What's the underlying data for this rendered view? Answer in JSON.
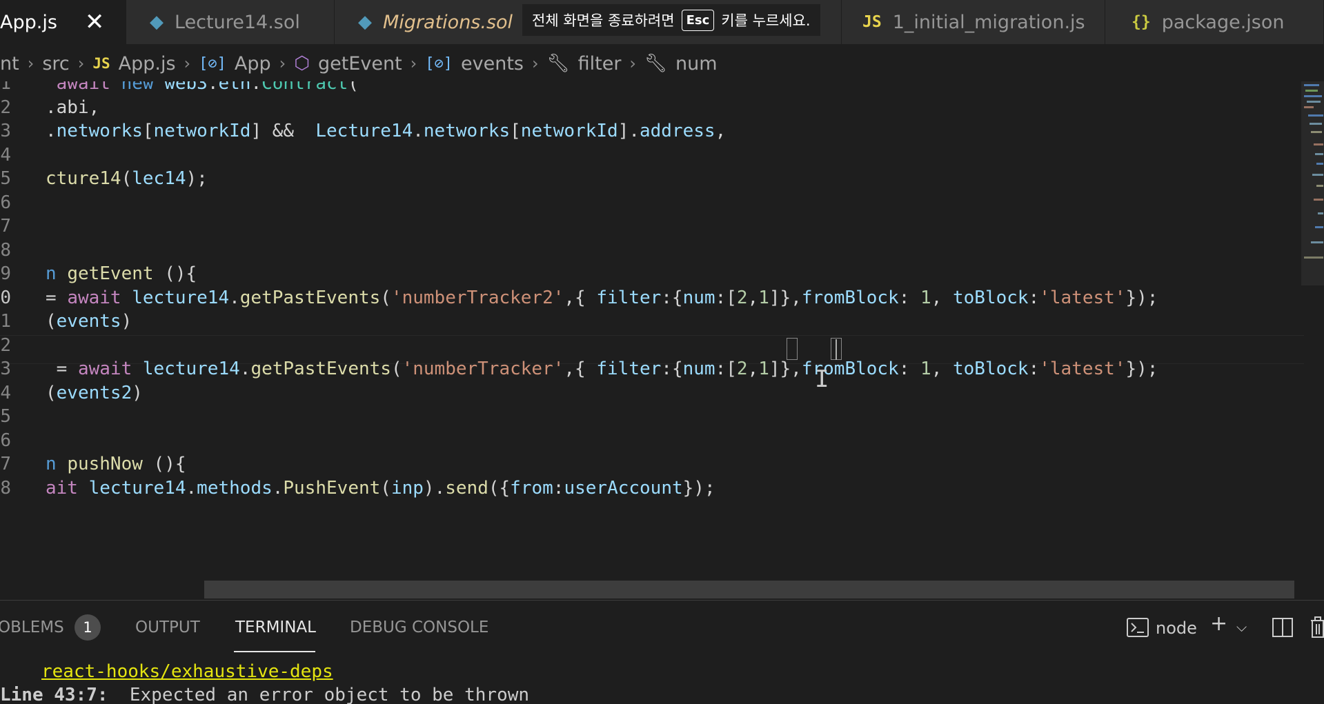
{
  "tabs": [
    {
      "label": "App.js",
      "icon": "JS",
      "kind": "js",
      "active": true
    },
    {
      "label": "Lecture14.sol",
      "icon": "◆",
      "kind": "sol",
      "active": false
    },
    {
      "label": "Migrations.sol",
      "icon": "◆",
      "kind": "sol",
      "active": false,
      "modified": true
    },
    {
      "label": "1_initial_migration.js",
      "icon": "JS",
      "kind": "js",
      "active": false
    },
    {
      "label": "package.json",
      "icon": "{}",
      "kind": "json",
      "active": false
    }
  ],
  "fullscreen_notice": {
    "before": "전체 화면을 종료하려면",
    "key": "Esc",
    "after": "키를 누르세요."
  },
  "breadcrumb": {
    "items": [
      "nt",
      "src",
      "App.js",
      "App",
      "getEvent",
      "events",
      "filter",
      "num"
    ],
    "js_badge": "JS"
  },
  "editor": {
    "line_numbers": [
      "1",
      "2",
      "3",
      "4",
      "5",
      "6",
      "7",
      "8",
      "9",
      "0",
      "1",
      "2",
      "3",
      "4",
      "5",
      "6",
      "7",
      "8"
    ],
    "current_line_index": 9,
    "lines": [
      [
        {
          "t": " await ",
          "c": "kw2"
        },
        {
          "t": "new ",
          "c": "kw"
        },
        {
          "t": "web3",
          "c": "vr"
        },
        {
          "t": ".",
          "c": "pu"
        },
        {
          "t": "eth",
          "c": "vr"
        },
        {
          "t": ".",
          "c": "pu"
        },
        {
          "t": "Contract",
          "c": "cl"
        },
        {
          "t": "(",
          "c": "pu"
        }
      ],
      [
        {
          "t": ".abi,",
          "c": "pu"
        }
      ],
      [
        {
          "t": ".",
          "c": "pu"
        },
        {
          "t": "networks",
          "c": "vr"
        },
        {
          "t": "[",
          "c": "pu"
        },
        {
          "t": "networkId",
          "c": "vr"
        },
        {
          "t": "] &&  ",
          "c": "pu"
        },
        {
          "t": "Lecture14",
          "c": "vr"
        },
        {
          "t": ".",
          "c": "pu"
        },
        {
          "t": "networks",
          "c": "vr"
        },
        {
          "t": "[",
          "c": "pu"
        },
        {
          "t": "networkId",
          "c": "vr"
        },
        {
          "t": "].",
          "c": "pu"
        },
        {
          "t": "address",
          "c": "vr"
        },
        {
          "t": ",",
          "c": "pu"
        }
      ],
      [],
      [
        {
          "t": "cture14",
          "c": "fn"
        },
        {
          "t": "(",
          "c": "pu"
        },
        {
          "t": "lec14",
          "c": "vr"
        },
        {
          "t": ");",
          "c": "pu"
        }
      ],
      [],
      [],
      [],
      [
        {
          "t": "n ",
          "c": "kw"
        },
        {
          "t": "getEvent",
          "c": "fn"
        },
        {
          "t": " (){",
          "c": "pu"
        }
      ],
      [
        {
          "t": "= ",
          "c": "pu"
        },
        {
          "t": "await ",
          "c": "kw2"
        },
        {
          "t": "lecture14",
          "c": "vr"
        },
        {
          "t": ".",
          "c": "pu"
        },
        {
          "t": "getPastEvents",
          "c": "fn"
        },
        {
          "t": "(",
          "c": "pu"
        },
        {
          "t": "'numberTracker2'",
          "c": "st"
        },
        {
          "t": ",{ ",
          "c": "pu"
        },
        {
          "t": "filter",
          "c": "vr"
        },
        {
          "t": ":{",
          "c": "pu"
        },
        {
          "t": "num",
          "c": "vr"
        },
        {
          "t": ":[",
          "c": "pu"
        },
        {
          "t": "2",
          "c": "nm"
        },
        {
          "t": ",",
          "c": "pu"
        },
        {
          "t": "1",
          "c": "nm"
        },
        {
          "t": "]},",
          "c": "pu"
        },
        {
          "t": "fromBlock",
          "c": "vr"
        },
        {
          "t": ": ",
          "c": "pu"
        },
        {
          "t": "1",
          "c": "nm"
        },
        {
          "t": ", ",
          "c": "pu"
        },
        {
          "t": "toBlock",
          "c": "vr"
        },
        {
          "t": ":",
          "c": "pu"
        },
        {
          "t": "'latest'",
          "c": "st"
        },
        {
          "t": "});",
          "c": "pu"
        }
      ],
      [
        {
          "t": "(",
          "c": "pu"
        },
        {
          "t": "events",
          "c": "vr"
        },
        {
          "t": ")",
          "c": "pu"
        }
      ],
      [],
      [
        {
          "t": " = ",
          "c": "pu"
        },
        {
          "t": "await ",
          "c": "kw2"
        },
        {
          "t": "lecture14",
          "c": "vr"
        },
        {
          "t": ".",
          "c": "pu"
        },
        {
          "t": "getPastEvents",
          "c": "fn"
        },
        {
          "t": "(",
          "c": "pu"
        },
        {
          "t": "'numberTracker'",
          "c": "st"
        },
        {
          "t": ",{ ",
          "c": "pu"
        },
        {
          "t": "filter",
          "c": "vr"
        },
        {
          "t": ":{",
          "c": "pu"
        },
        {
          "t": "num",
          "c": "vr"
        },
        {
          "t": ":[",
          "c": "pu"
        },
        {
          "t": "2",
          "c": "nm"
        },
        {
          "t": ",",
          "c": "pu"
        },
        {
          "t": "1",
          "c": "nm"
        },
        {
          "t": "]},",
          "c": "pu"
        },
        {
          "t": "fromBlock",
          "c": "vr"
        },
        {
          "t": ": ",
          "c": "pu"
        },
        {
          "t": "1",
          "c": "nm"
        },
        {
          "t": ", ",
          "c": "pu"
        },
        {
          "t": "toBlock",
          "c": "vr"
        },
        {
          "t": ":",
          "c": "pu"
        },
        {
          "t": "'latest'",
          "c": "st"
        },
        {
          "t": "});",
          "c": "pu"
        }
      ],
      [
        {
          "t": "(",
          "c": "pu"
        },
        {
          "t": "events2",
          "c": "vr"
        },
        {
          "t": ")",
          "c": "pu"
        }
      ],
      [],
      [],
      [
        {
          "t": "n ",
          "c": "kw"
        },
        {
          "t": "pushNow",
          "c": "fn"
        },
        {
          "t": " (){",
          "c": "pu"
        }
      ],
      [
        {
          "t": "ait ",
          "c": "kw2"
        },
        {
          "t": "lecture14",
          "c": "vr"
        },
        {
          "t": ".",
          "c": "pu"
        },
        {
          "t": "methods",
          "c": "vr"
        },
        {
          "t": ".",
          "c": "pu"
        },
        {
          "t": "PushEvent",
          "c": "fn"
        },
        {
          "t": "(",
          "c": "pu"
        },
        {
          "t": "inp",
          "c": "vr"
        },
        {
          "t": ").",
          "c": "pu"
        },
        {
          "t": "send",
          "c": "fn"
        },
        {
          "t": "({",
          "c": "pu"
        },
        {
          "t": "from",
          "c": "vr"
        },
        {
          "t": ":",
          "c": "pu"
        },
        {
          "t": "userAccount",
          "c": "vr"
        },
        {
          "t": "});",
          "c": "pu"
        }
      ]
    ]
  },
  "panel": {
    "tabs": {
      "problems": "OBLEMS",
      "output": "OUTPUT",
      "terminal": "TERMINAL",
      "debug_console": "DEBUG CONSOLE"
    },
    "problems_count": "1",
    "terminal_shell": "node",
    "terminal_lines": {
      "rule": "react-hooks/exhaustive-deps",
      "location": "Line 43:7:",
      "message": "  Expected an error object to be thrown"
    }
  }
}
